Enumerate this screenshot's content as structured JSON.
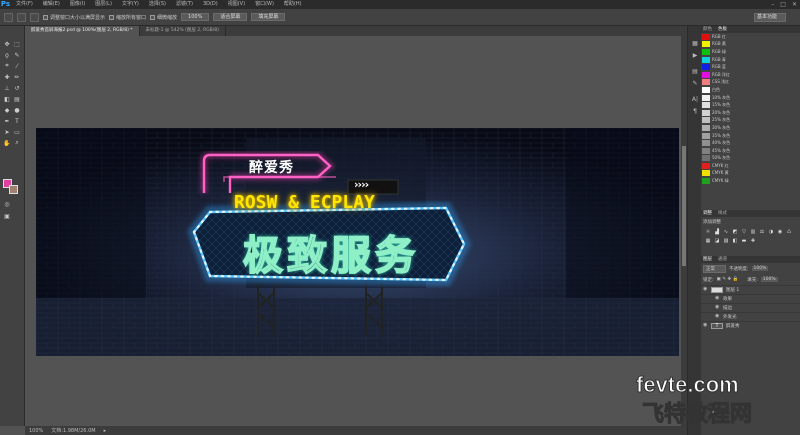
{
  "app": {
    "logo": "Ps"
  },
  "menu": [
    "文件(F)",
    "编辑(E)",
    "图像(I)",
    "图层(L)",
    "文字(Y)",
    "选择(S)",
    "滤镜(T)",
    "3D(D)",
    "视图(V)",
    "窗口(W)",
    "帮助(H)"
  ],
  "options": {
    "resize_label": "调整窗口大小以满屏显示",
    "zoom_all_label": "缩放所有窗口",
    "scrubby_label": "细微缩放",
    "zoom_level": "100%",
    "fit_screen": "适合屏幕",
    "fill_screen": "填充屏幕",
    "workspace": "基本功能"
  },
  "tabs": [
    {
      "label": "醉爱秀首屏海报2.psd @ 100%(图层 2, RGB/8) *",
      "active": true
    },
    {
      "label": "未标题-1 @ 542% (图层 2, RGB/8)",
      "active": false
    }
  ],
  "status": {
    "zoom": "100%",
    "doc": "文档:1.98M/26.0M"
  },
  "banner": {
    "small_label": "醉爱秀",
    "arrows": "››››",
    "subtitle": "ROSW & ECPLAY",
    "main_title": "极致服务",
    "colors": {
      "pink": "#ff3fb3",
      "yellow": "#ffe600",
      "blue": "#2fa8ff",
      "mint": "#8ff0c8",
      "dark": "#0d1020"
    }
  },
  "swatches_panel": {
    "tabs": [
      "颜色",
      "色板"
    ],
    "items": [
      {
        "color": "#e01010",
        "label": "RGB 红"
      },
      {
        "color": "#f0f000",
        "label": "RGB 黄"
      },
      {
        "color": "#10c010",
        "label": "RGB 绿"
      },
      {
        "color": "#10d0e0",
        "label": "RGB 青"
      },
      {
        "color": "#1020e0",
        "label": "RGB 蓝"
      },
      {
        "color": "#e010e0",
        "label": "RGB 洋红"
      },
      {
        "color": "#f08080",
        "label": "CSS 浅红"
      },
      {
        "color": "#ffffff",
        "label": "白色"
      },
      {
        "color": "#f0f0f0",
        "label": "10% 灰色"
      },
      {
        "color": "#e0e0e0",
        "label": "15% 灰色"
      },
      {
        "color": "#d0d0d0",
        "label": "20% 灰色"
      },
      {
        "color": "#c0c0c0",
        "label": "25% 灰色"
      },
      {
        "color": "#b0b0b0",
        "label": "30% 灰色"
      },
      {
        "color": "#a0a0a0",
        "label": "35% 灰色"
      },
      {
        "color": "#909090",
        "label": "40% 灰色"
      },
      {
        "color": "#808080",
        "label": "45% 灰色"
      },
      {
        "color": "#707070",
        "label": "50% 灰色"
      },
      {
        "color": "#e02020",
        "label": "CMYK 红"
      },
      {
        "color": "#f0e000",
        "label": "CMYK 黄"
      },
      {
        "color": "#20a020",
        "label": "CMYK 绿"
      }
    ]
  },
  "adjustments": {
    "tabs": [
      "调整",
      "样式"
    ],
    "title": "添加调整"
  },
  "layers": {
    "tabs": [
      "图层",
      "通道"
    ],
    "blend_mode": "正常",
    "opacity_label": "不透明度:",
    "opacity": "100%",
    "lock_label": "锁定:",
    "fill_label": "填充:",
    "fill": "100%",
    "rows": [
      {
        "name": "图层 1",
        "type": "image"
      },
      {
        "name": "效果",
        "type": "fx"
      },
      {
        "name": "描边",
        "type": "fx"
      },
      {
        "name": "外发光",
        "type": "fx"
      },
      {
        "name": "醉爱秀",
        "type": "text"
      }
    ]
  },
  "watermark": {
    "top": "fevte.com",
    "bottom": "飞特教程网"
  }
}
